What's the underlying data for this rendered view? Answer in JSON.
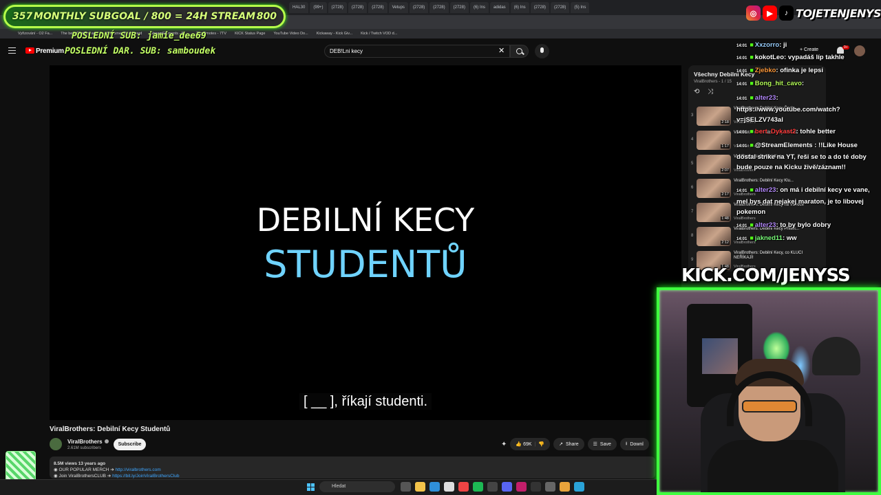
{
  "browser": {
    "tabs": [
      "HAL30",
      "(99+)",
      "(2728)",
      "(2728)",
      "(2728)",
      "Vetups",
      "(2728)",
      "(2728)",
      "(2728)",
      "(6) Ins",
      "adidas",
      "(6) Ins",
      "(2728)",
      "(2728)",
      "(5) Ins"
    ],
    "bookmarks": [
      "Vyřizování - O2 Fa...",
      "The best ChatBot an...",
      "Streamer Dashboard",
      "StreamElements - M...",
      "Top Emotes - 7TV",
      "KICK Status Page",
      "YouTube Video Do...",
      "Kickaway - Kick Giv...",
      "Kick / Twitch VOD d..."
    ]
  },
  "overlay": {
    "subgoal_count": "357",
    "subgoal_text": "MONTHLY SUBGOAL / 800 = 24H STREAM",
    "subgoal_target": "800",
    "last_sub": "POSLEDNÍ SUB: jamie_dee69",
    "last_donation": "POSLEDNÍ DAR. SUB: samboudek",
    "handle": "TOJETENJENYS",
    "kick_url": "KICK.COM/JENYSS"
  },
  "youtube": {
    "logo_label": "Premium",
    "search_value": "DEB!Lni kecy",
    "create_label": "Create",
    "notif_count": "9+"
  },
  "video": {
    "frame_line1": "DEBILNÍ KECY",
    "frame_line2": "STUDENTŮ",
    "caption": "[ __ ], říkají studenti.",
    "title": "ViralBrothers: Debilní Kecy Studentů",
    "channel": "ViralBrothers",
    "subscribers": "2.61M subscribers",
    "subscribe_label": "Subscribe",
    "likes": "69K",
    "share_label": "Share",
    "save_label": "Save",
    "download_label": "Downl",
    "views": "8.5M views  13 years ago",
    "desc_line1_label": "OUR POPULAR MERCH ➔",
    "desc_line1_link": "http://viralbrothers.com",
    "desc_line2_label": "Join ViralBrothersCLUB ➔",
    "desc_line2_link": "https://bit.ly/JoinViralBrothersClub"
  },
  "playlist": {
    "title": "Všechny Debilní Kecy",
    "sub": "ViralBrothers - 1 / 15",
    "items": [
      {
        "num": "3",
        "name": "ViralBrothers: Debilní Kecy Čech...",
        "chan": "ViralBrothers",
        "dur": "2:18"
      },
      {
        "num": "4",
        "name": "ViralBrothers: Debilní Kecy Učitelů",
        "chan": "ViralBrothers",
        "dur": "1:17"
      },
      {
        "num": "5",
        "name": "ViralBrothers: Debilní Kecy",
        "chan": "ViralBrothers",
        "dur": "2:07"
      },
      {
        "num": "6",
        "name": "ViralBrothers: Debilní Kecy Klu...",
        "chan": "ViralBrothers",
        "dur": "2:17"
      },
      {
        "num": "7",
        "name": "ViralBrothers: Debilní Kecy na Vánoce",
        "chan": "ViralBrothers",
        "dur": "1:48"
      },
      {
        "num": "8",
        "name": "ViralBrothers: Debilní Kecy Přítelk...",
        "chan": "ViralBrothers",
        "dur": "2:12"
      },
      {
        "num": "9",
        "name": "ViralBrothers: Debilní Kecy, co KLUCI NEŘÍKAJÍ!",
        "chan": "ViralBrothers",
        "dur": "1:48"
      }
    ]
  },
  "chat": [
    {
      "time": "14:01",
      "user": "Xxzorro",
      "color": "#9ad0ff",
      "msg": ": ji"
    },
    {
      "time": "14:01",
      "user": "kokotLeo",
      "color": "#ffffff",
      "msg": ": vypadáš líp takhle"
    },
    {
      "time": "14:01",
      "user": "Zjebko",
      "color": "#ff9a3c",
      "msg": ": ofinka je lepsi"
    },
    {
      "time": "14:01",
      "user": "Bong_hit_cavo",
      "color": "#b6ff5a",
      "msg": ":"
    },
    {
      "time": "14:01",
      "user": "alter23",
      "color": "#b78cff",
      "msg": ": https://www.youtube.com/watch?v=jSELZV743al"
    },
    {
      "time": "14:01",
      "user": "bert_Dykast2",
      "color": "#ff3c3c",
      "msg": ": tohle better"
    },
    {
      "time": "14:01",
      "user": "",
      "color": "#7cff7c",
      "msg": "@StreamElements : !!Like House dostal strike na YT, řeši se to a do té doby bude pouze na Kicku živě/záznam!!"
    },
    {
      "time": "14:01",
      "user": "alter23",
      "color": "#b78cff",
      "msg": ": on má i debilní kecy ve vane, mel bys dat nejakej maraton, je to libovej pokemon"
    },
    {
      "time": "14:01",
      "user": "alter23",
      "color": "#b78cff",
      "msg": ": to by bylo dobry"
    },
    {
      "time": "14:01",
      "user": "jakned11",
      "color": "#7cff7c",
      "msg": ": ww"
    }
  ],
  "taskbar": {
    "search_label": "Hledat"
  },
  "colors": {
    "accent_green": "#53fc18",
    "yt_red": "#ff0000",
    "studentu_blue": "#6fd3ff"
  }
}
